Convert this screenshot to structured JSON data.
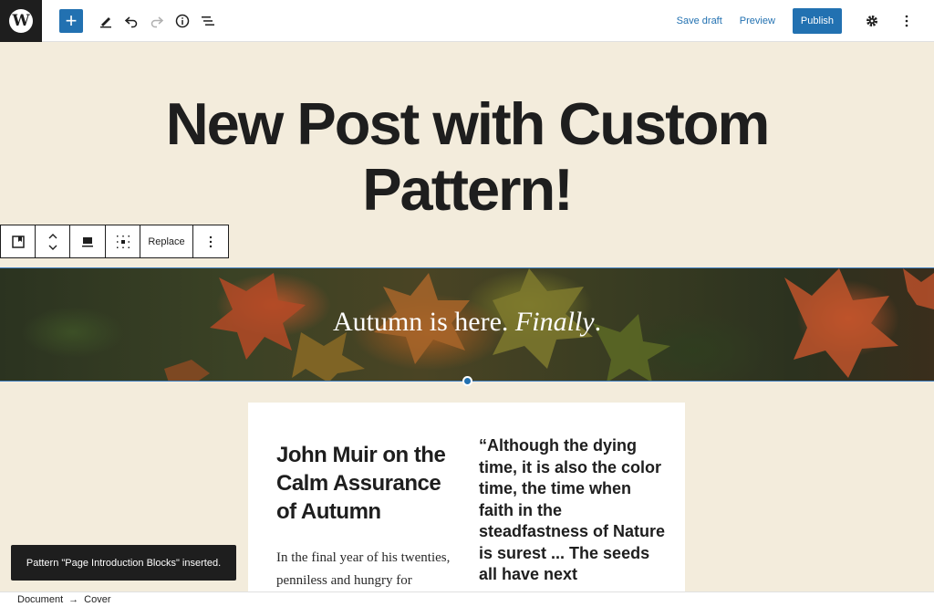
{
  "topbar": {
    "logo_letter": "W",
    "inserter_label": "+",
    "save_draft_label": "Save draft",
    "preview_label": "Preview",
    "publish_label": "Publish"
  },
  "post": {
    "title_line1": "New Post with Custom",
    "title_line2": "Pattern!"
  },
  "block_toolbar": {
    "replace_label": "Replace"
  },
  "cover": {
    "text_plain": "Autumn is here. ",
    "text_italic": "Finally",
    "text_end": "."
  },
  "card": {
    "heading": "John Muir on the Calm Assurance of Autumn",
    "body": "In the final year of his twenties, penniless and hungry for",
    "quote": "“Although the dying time, it is also the color time, the time when faith in the steadfastness of Nature is surest ... The seeds all have next"
  },
  "snackbar": {
    "message": "Pattern \"Page Introduction Blocks\" inserted."
  },
  "breadcrumb": {
    "items": [
      "Document",
      "Cover"
    ],
    "separator": "→"
  },
  "colors": {
    "accent": "#2271b1",
    "background": "#f3ecdc",
    "dark": "#1e1e1e"
  }
}
